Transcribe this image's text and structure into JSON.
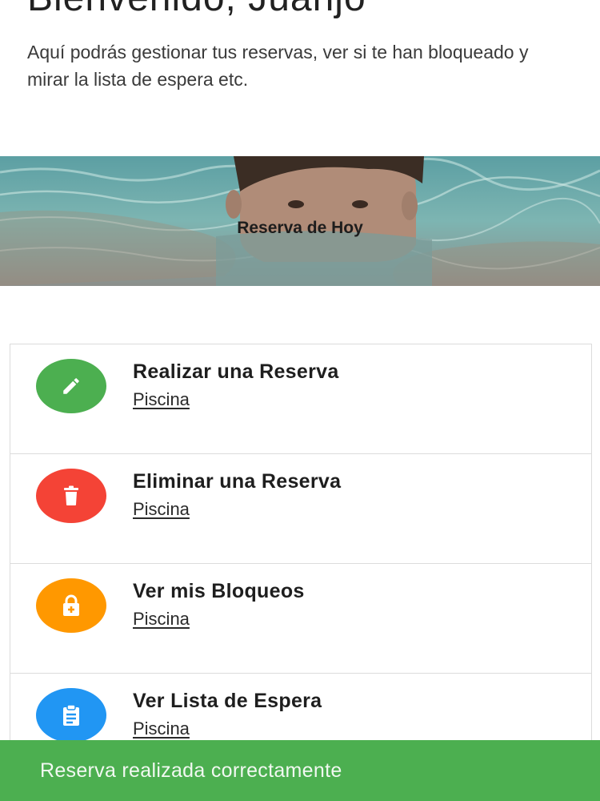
{
  "welcome": {
    "title": "Bienvenido, Juanjo",
    "description": "Aquí podrás gestionar tus reservas, ver si te han bloqueado y mirar la lista de espera etc."
  },
  "hero": {
    "caption": "Reserva de Hoy"
  },
  "menu": {
    "items": [
      {
        "label": "Realizar una Reserva",
        "subtitle": "Piscina",
        "icon": "pencil-icon",
        "color": "#4caf50"
      },
      {
        "label": "Eliminar una Reserva",
        "subtitle": "Piscina",
        "icon": "trash-icon",
        "color": "#f44336"
      },
      {
        "label": "Ver mis Bloqueos",
        "subtitle": "Piscina",
        "icon": "lock-add-icon",
        "color": "#ff9800"
      },
      {
        "label": "Ver Lista de Espera",
        "subtitle": "Piscina",
        "icon": "clipboard-list-icon",
        "color": "#2196f3"
      }
    ]
  },
  "snackbar": {
    "message": "Reserva realizada correctamente",
    "color": "#4caf50"
  }
}
